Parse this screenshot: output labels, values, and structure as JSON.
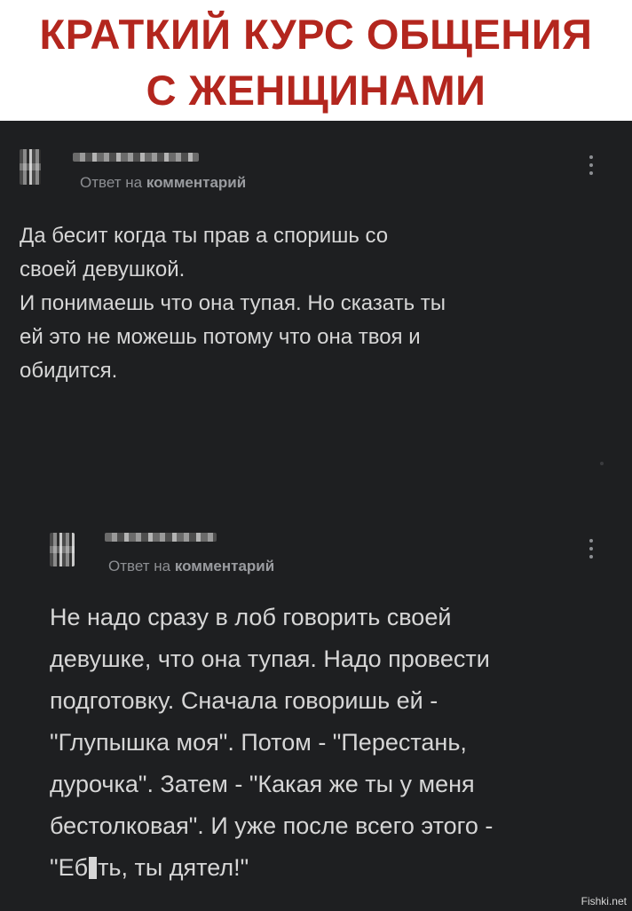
{
  "header": {
    "line1": "КРАТКИЙ КУРС ОБЩЕНИЯ",
    "line2": "С ЖЕНЩИНАМИ"
  },
  "comments": [
    {
      "reply_prefix": "Ответ на ",
      "reply_target": "комментарий",
      "text": "Да бесит когда ты прав а споришь со\nсвоей девушкой.\nИ понимаешь что она тупая. Но сказать ты\nей это не можешь потому что она твоя и\nобидится."
    },
    {
      "reply_prefix": "Ответ на ",
      "reply_target": "комментарий",
      "text_main": "Не надо сразу в лоб говорить своей\nдевушке, что она тупая. Надо провести\nподготовку. Сначала говоришь ей -\n\"Глупышка моя\". Потом - \"Перестань,\nдурочка\". Затем - \"Какая же ты у меня\nбестолковая\". И уже после всего этого -\n",
      "text_censored_start": "\"Еб",
      "text_censored_end": "ть, ты дятел!\""
    }
  ],
  "watermark": "Fishki.net"
}
